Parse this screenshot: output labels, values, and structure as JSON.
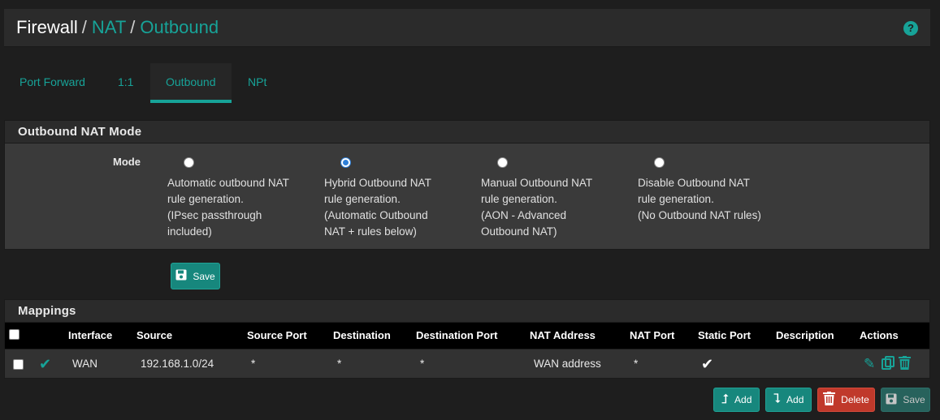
{
  "breadcrumb": {
    "root": "Firewall",
    "level2": "NAT",
    "current": "Outbound",
    "separator": "/"
  },
  "help_icon": "?",
  "tabs": [
    {
      "label": "Port Forward"
    },
    {
      "label": "1:1"
    },
    {
      "label": "Outbound"
    },
    {
      "label": "NPt"
    }
  ],
  "active_tab": "Outbound",
  "mode_panel": {
    "title": "Outbound NAT Mode",
    "mode_label": "Mode",
    "selected": "hybrid",
    "options": [
      {
        "id": "automatic",
        "lines": [
          "Automatic outbound NAT",
          "rule generation.",
          "(IPsec passthrough",
          "included)"
        ]
      },
      {
        "id": "hybrid",
        "lines": [
          "Hybrid Outbound NAT",
          "rule generation.",
          "(Automatic Outbound",
          "NAT + rules below)"
        ]
      },
      {
        "id": "manual",
        "lines": [
          "Manual Outbound NAT",
          "rule generation.",
          "(AON - Advanced",
          "Outbound NAT)"
        ]
      },
      {
        "id": "disable",
        "lines": [
          "Disable Outbound NAT",
          "rule generation.",
          "(No Outbound NAT rules)"
        ]
      }
    ]
  },
  "save_button": {
    "label": "Save"
  },
  "mappings": {
    "title": "Mappings",
    "columns": {
      "interface": "Interface",
      "source": "Source",
      "source_port": "Source Port",
      "destination": "Destination",
      "destination_port": "Destination Port",
      "nat_address": "NAT Address",
      "nat_port": "NAT Port",
      "static_port": "Static Port",
      "description": "Description",
      "actions": "Actions"
    },
    "rows": [
      {
        "enabled": true,
        "interface": "WAN",
        "source": "192.168.1.0/24",
        "source_port": "*",
        "destination": "*",
        "destination_port": "*",
        "nat_address": "WAN address",
        "nat_port": "*",
        "static_port": true,
        "description": ""
      }
    ]
  },
  "bottom_buttons": {
    "add_top": "Add",
    "add_bottom": "Add",
    "delete": "Delete",
    "save": "Save"
  },
  "colors": {
    "accent": "#17a398",
    "danger": "#c0392b",
    "background": "#1e1e1e",
    "panel": "#3a3a3a"
  }
}
